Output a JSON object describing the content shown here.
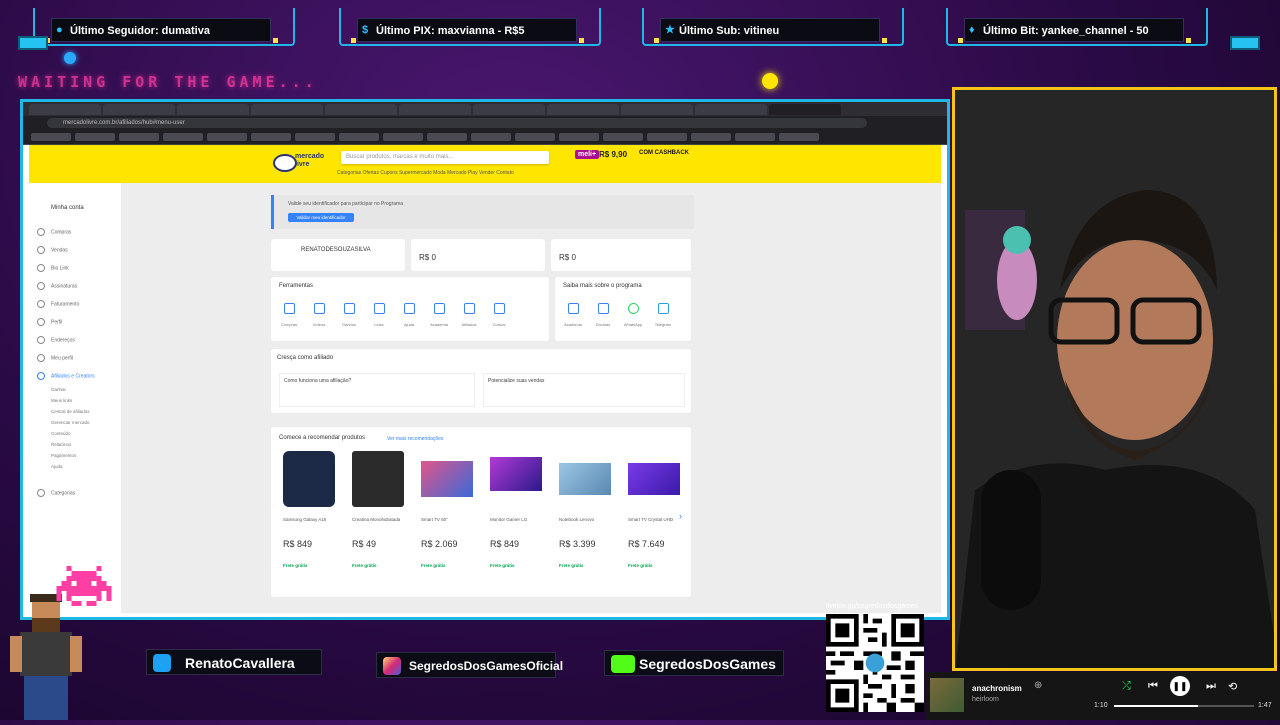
{
  "alerts": [
    {
      "icon": "person-icon",
      "label": "Último Seguidor: dumativa"
    },
    {
      "icon": "dollar-icon",
      "label": "Último PIX: maxvianna - R$5"
    },
    {
      "icon": "star-icon",
      "label": "Último Sub: vitineu"
    },
    {
      "icon": "diamond-icon",
      "label": "Último Bit: yankee_channel - 50"
    }
  ],
  "waiting_text": "WAITING FOR THE GAME...",
  "browser": {
    "url": "mercadolivre.com.br/afiliados/hub#menu-user",
    "ml": {
      "logo": "mercado livre",
      "search_placeholder": "Buscar produtos, marcas e muito mais...",
      "promo_badge": "meli+",
      "promo_price": "R$ 9,90",
      "promo_text": "COM CASHBACK",
      "nav": "Categorias   Ofertas   Cupons   Supermercado   Moda   Mercado Play   Vender   Contato",
      "sidebar_title": "Minha conta",
      "sidebar": [
        "Compras",
        "Vendas",
        "Bio Link",
        "Assinaturas",
        "Faturamento",
        "Perfil",
        "Endereços",
        "Meu perfil",
        "Afiliados e Creators",
        "Categorias"
      ],
      "sidebar_sub": [
        "Ganhar",
        "Meus links",
        "Central de afiliados",
        "Gerenciar mercado",
        "Conteúdo",
        "Relatórios",
        "Pagamentos",
        "Ajuda"
      ],
      "info_text": "Valide seu identificador para participar no Programa",
      "info_button": "Validar meu identificador",
      "account_name": "RENATODESOUZASILVA",
      "stat1_value": "R$ 0",
      "stat2_value": "R$ 0",
      "tools_title": "Ferramentas",
      "tools": [
        "Compras",
        "Vídeos",
        "Ganhos",
        "Links",
        "Ajuda",
        "Academia",
        "Afiliados",
        "Cursos"
      ],
      "learn_title": "Saiba mais sobre o programa",
      "learn": [
        "Academia",
        "Dúvidas",
        "WhatsApp",
        "Telegram"
      ],
      "grow_title": "Cresça como afiliado",
      "grow_card1": "Como funciona uma afiliação?",
      "grow_card2": "Potencialize suas vendas",
      "products_title": "Comece a recomendar produtos",
      "products_link": "Ver mais recomendações",
      "products": [
        {
          "name": "Samsung Galaxy A15",
          "price": "R$ 849",
          "color": "#1c2a48"
        },
        {
          "name": "Creatina Monohidratada",
          "price": "R$ 49",
          "color": "#2b2b2b"
        },
        {
          "name": "Smart TV 50\"",
          "price": "R$ 2.069",
          "color": "#c23a5a"
        },
        {
          "name": "Monitor Gamer LG",
          "price": "R$ 849",
          "color": "#6a2aa8"
        },
        {
          "name": "Notebook Lenovo",
          "price": "R$ 3.399",
          "color": "#7aa8c8"
        },
        {
          "name": "Smart TV Crystal UHD",
          "price": "R$ 7.649",
          "color": "#5a2ec8"
        }
      ],
      "frete": "Frete grátis"
    }
  },
  "socials": [
    {
      "icon": "twitter-icon",
      "label": "RenatoCavallera",
      "color": "#1da1f2"
    },
    {
      "icon": "instagram-icon",
      "label": "SegredosDosGamesOficial",
      "color": "#d6249f"
    },
    {
      "icon": "kick-icon",
      "label": "SegredosDosGames",
      "color": "#53fc18"
    }
  ],
  "qr_label": "livepix.gg/segredosdosgames",
  "player": {
    "artist": "anachronism",
    "track": "heirloom",
    "elapsed": "1:10",
    "total": "1:47",
    "progress": 0.6
  }
}
